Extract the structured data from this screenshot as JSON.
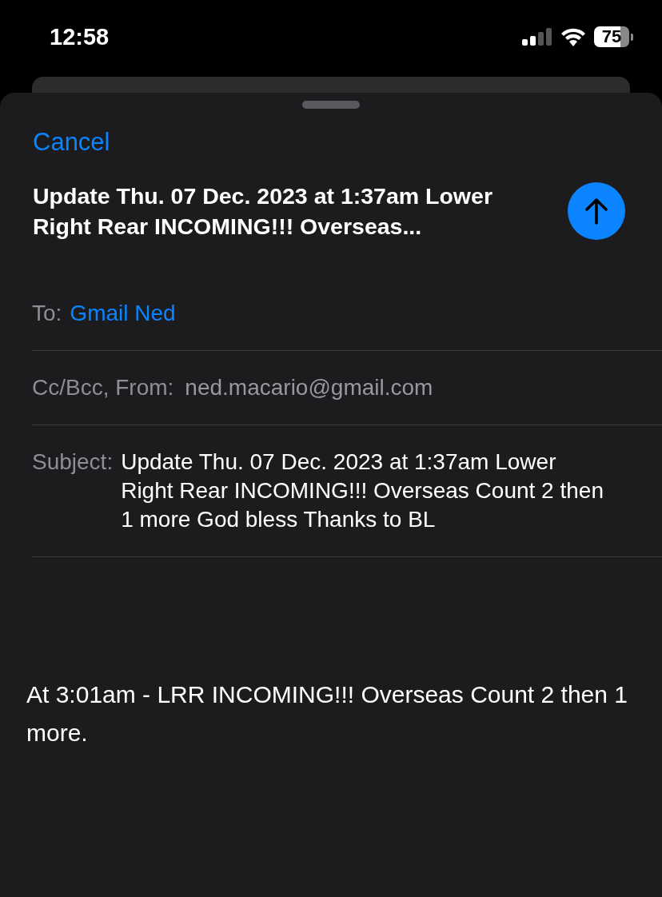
{
  "status_bar": {
    "time": "12:58",
    "battery": "75"
  },
  "compose": {
    "cancel": "Cancel",
    "title": "Update Thu. 07 Dec. 2023 at 1:37am Lower Right Rear INCOMING!!! Overseas...",
    "fields": [
      {
        "kind": "to",
        "label": "To:",
        "value": "Gmail Ned"
      },
      {
        "kind": "from",
        "label": "Cc/Bcc, From:",
        "value": "ned.macario@gmail.com"
      },
      {
        "kind": "subject",
        "label": "Subject:",
        "value": "Update Thu. 07 Dec. 2023 at 1:37am Lower Right Rear INCOMING!!! Overseas Count 2 then 1 more God bless Thanks to BL"
      }
    ],
    "body": "At 3:01am - LRR INCOMING!!! Overseas Count 2 then 1 more."
  }
}
